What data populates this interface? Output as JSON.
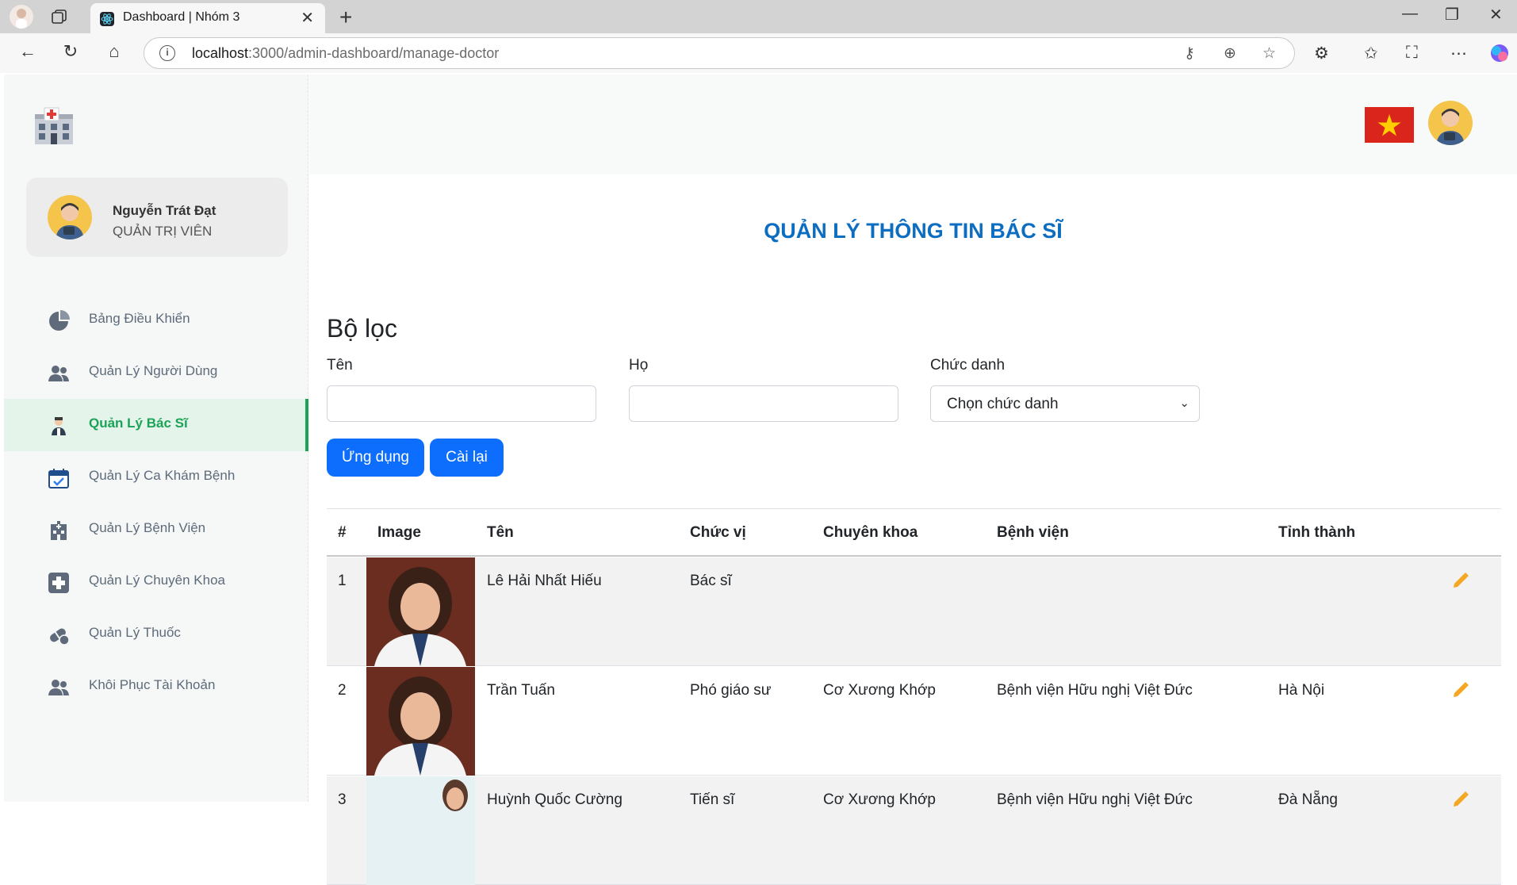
{
  "browser": {
    "tab_title": "Dashboard | Nhóm 3",
    "url_host": "localhost",
    "url_path": ":3000/admin-dashboard/manage-doctor"
  },
  "sidebar": {
    "user_name": "Nguyễn Trát Đạt",
    "user_role": "QUẢN TRỊ VIÊN",
    "items": [
      {
        "label": "Bảng Điều Khiển",
        "icon": "pie-chart-icon"
      },
      {
        "label": "Quản Lý Người Dùng",
        "icon": "users-icon"
      },
      {
        "label": "Quản Lý Bác Sĩ",
        "icon": "doctor-icon",
        "active": true
      },
      {
        "label": "Quản Lý Ca Khám Bệnh",
        "icon": "calendar-check-icon"
      },
      {
        "label": "Quản Lý Bệnh Viện",
        "icon": "hospital-icon"
      },
      {
        "label": "Quản Lý Chuyên Khoa",
        "icon": "plus-square-icon"
      },
      {
        "label": "Quản Lý Thuốc",
        "icon": "pills-icon"
      },
      {
        "label": "Khôi Phục Tài Khoản",
        "icon": "users-icon"
      }
    ]
  },
  "main": {
    "title": "QUẢN LÝ THÔNG TIN BÁC SĨ",
    "filter": {
      "title": "Bộ lọc",
      "first_name_label": "Tên",
      "last_name_label": "Họ",
      "position_label": "Chức danh",
      "position_value": "Chọn chức danh",
      "apply_label": "Ứng dụng",
      "reset_label": "Cài lại"
    },
    "table": {
      "headers": [
        "#",
        "Image",
        "Tên",
        "Chức vị",
        "Chuyên khoa",
        "Bệnh viện",
        "Tỉnh thành"
      ],
      "rows": [
        {
          "no": "1",
          "name": "Lê Hải Nhất Hiếu",
          "position": "Bác sĩ",
          "specialty": "",
          "hospital": "",
          "province": ""
        },
        {
          "no": "2",
          "name": "Trần Tuấn",
          "position": "Phó giáo sư",
          "specialty": "Cơ Xương Khớp",
          "hospital": "Bệnh viện Hữu nghị Việt Đức",
          "province": "Hà Nội"
        },
        {
          "no": "3",
          "name": "Huỳnh Quốc Cường",
          "position": "Tiến sĩ",
          "specialty": "Cơ Xương Khớp",
          "hospital": "Bệnh viện Hữu nghị Việt Đức",
          "province": "Đà Nẵng"
        }
      ]
    }
  },
  "colors": {
    "accent": "#0d6efd",
    "title": "#0d6ec1",
    "active_menu": "#1aa357",
    "edit": "#f5a623"
  }
}
